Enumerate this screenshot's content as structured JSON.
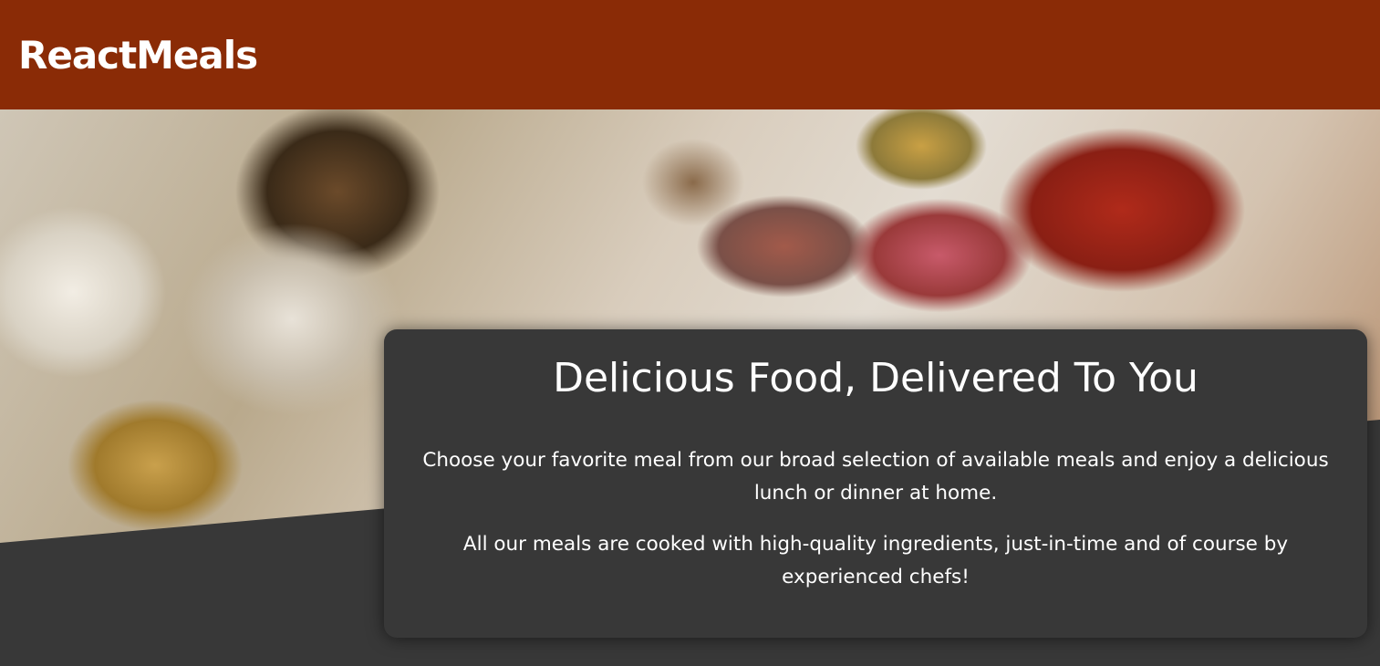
{
  "header": {
    "brand": "ReactMeals"
  },
  "hero": {
    "image_alt": "A table full of delicious food!",
    "title": "Delicious Food, Delivered To You",
    "paragraphs": [
      "Choose your favorite meal from our broad selection of available meals and enjoy a delicious lunch or dinner at home.",
      "All our meals are cooked with high-quality ingredients, just-in-time and of course by experienced chefs!"
    ]
  },
  "colors": {
    "header_bg": "#8a2b06",
    "page_bg": "#383838",
    "panel_bg": "#383838",
    "text": "#ffffff"
  }
}
